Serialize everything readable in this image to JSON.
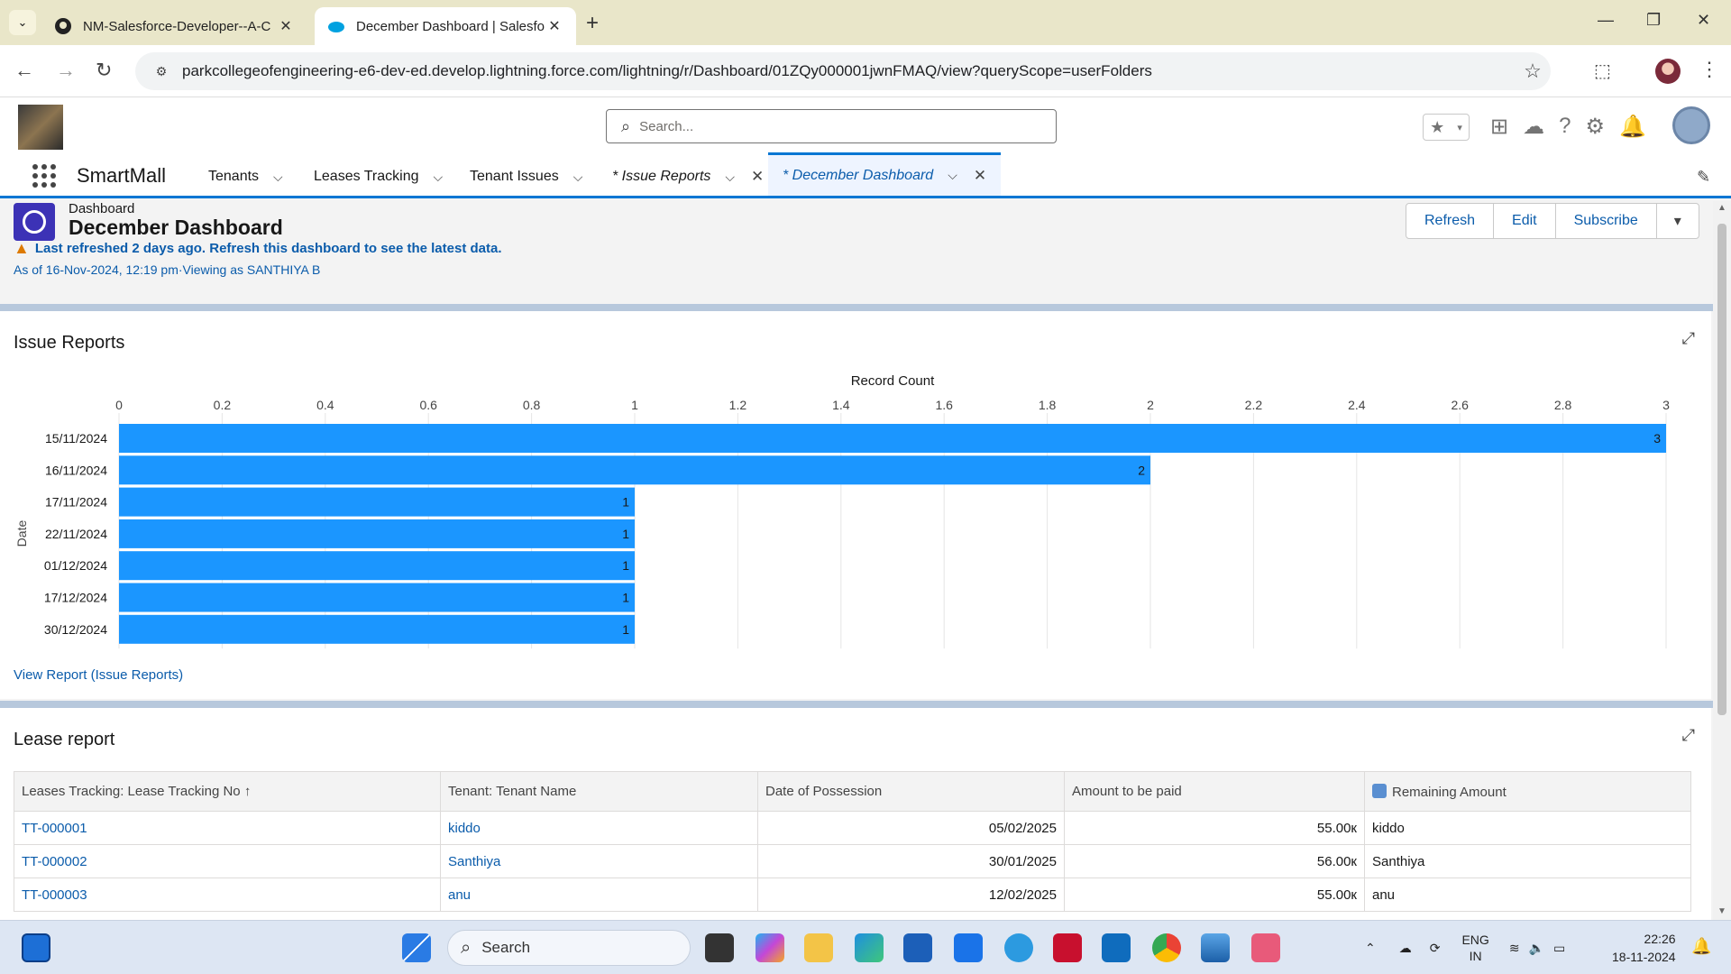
{
  "browser": {
    "tabs": [
      {
        "title": "NM-Salesforce-Developer--A-C",
        "active": false
      },
      {
        "title": "December Dashboard | Salesfor",
        "active": true
      }
    ],
    "url": "parkcollegeofengineering-e6-dev-ed.develop.lightning.force.com/lightning/r/Dashboard/01ZQy000001jwnFMAQ/view?queryScope=userFolders"
  },
  "sf": {
    "search_placeholder": "Search...",
    "app_name": "SmartMall",
    "nav": [
      {
        "label": "Tenants"
      },
      {
        "label": "Leases Tracking"
      },
      {
        "label": "Tenant Issues"
      },
      {
        "label": "* Issue Reports"
      },
      {
        "label": "* December Dashboard"
      }
    ]
  },
  "dashboard": {
    "type_label": "Dashboard",
    "title": "December Dashboard",
    "warning": "Last refreshed 2 days ago. Refresh this dashboard to see the latest data.",
    "as_of": "As of 16-Nov-2024, 12:19 pm·Viewing as SANTHIYA B",
    "buttons": {
      "refresh": "Refresh",
      "edit": "Edit",
      "subscribe": "Subscribe"
    }
  },
  "issue_widget": {
    "title": "Issue Reports",
    "view_report": "View Report (Issue Reports)"
  },
  "chart_data": {
    "type": "bar",
    "orientation": "horizontal",
    "title": "",
    "xlabel": "Record Count",
    "ylabel": "Date",
    "xlim": [
      0,
      3
    ],
    "xticks": [
      "0",
      "0.2",
      "0.4",
      "0.6",
      "0.8",
      "1",
      "1.2",
      "1.4",
      "1.6",
      "1.8",
      "2",
      "2.2",
      "2.4",
      "2.6",
      "2.8",
      "3"
    ],
    "categories": [
      "15/11/2024",
      "16/11/2024",
      "17/11/2024",
      "22/11/2024",
      "01/12/2024",
      "17/12/2024",
      "30/12/2024"
    ],
    "values": [
      3,
      2,
      1,
      1,
      1,
      1,
      1
    ],
    "grid": true,
    "color": "#1b96ff"
  },
  "lease_widget": {
    "title": "Lease report",
    "columns": [
      "Leases Tracking: Lease Tracking No",
      "Tenant: Tenant Name",
      "Date of Possession",
      "Amount to be paid",
      "Remaining Amount"
    ],
    "sort_indicator": "↑",
    "rows": [
      {
        "no": "TT-000001",
        "tenant": "kiddo",
        "date": "05/02/2025",
        "amount": "55.00к",
        "remaining": "kiddo"
      },
      {
        "no": "TT-000002",
        "tenant": "Santhiya",
        "date": "30/01/2025",
        "amount": "56.00к",
        "remaining": "Santhiya"
      },
      {
        "no": "TT-000003",
        "tenant": "anu",
        "date": "12/02/2025",
        "amount": "55.00к",
        "remaining": "anu"
      }
    ]
  },
  "taskbar": {
    "search_label": "Search",
    "lang_top": "ENG",
    "lang_bottom": "IN",
    "time": "22:26",
    "date": "18-11-2024"
  }
}
